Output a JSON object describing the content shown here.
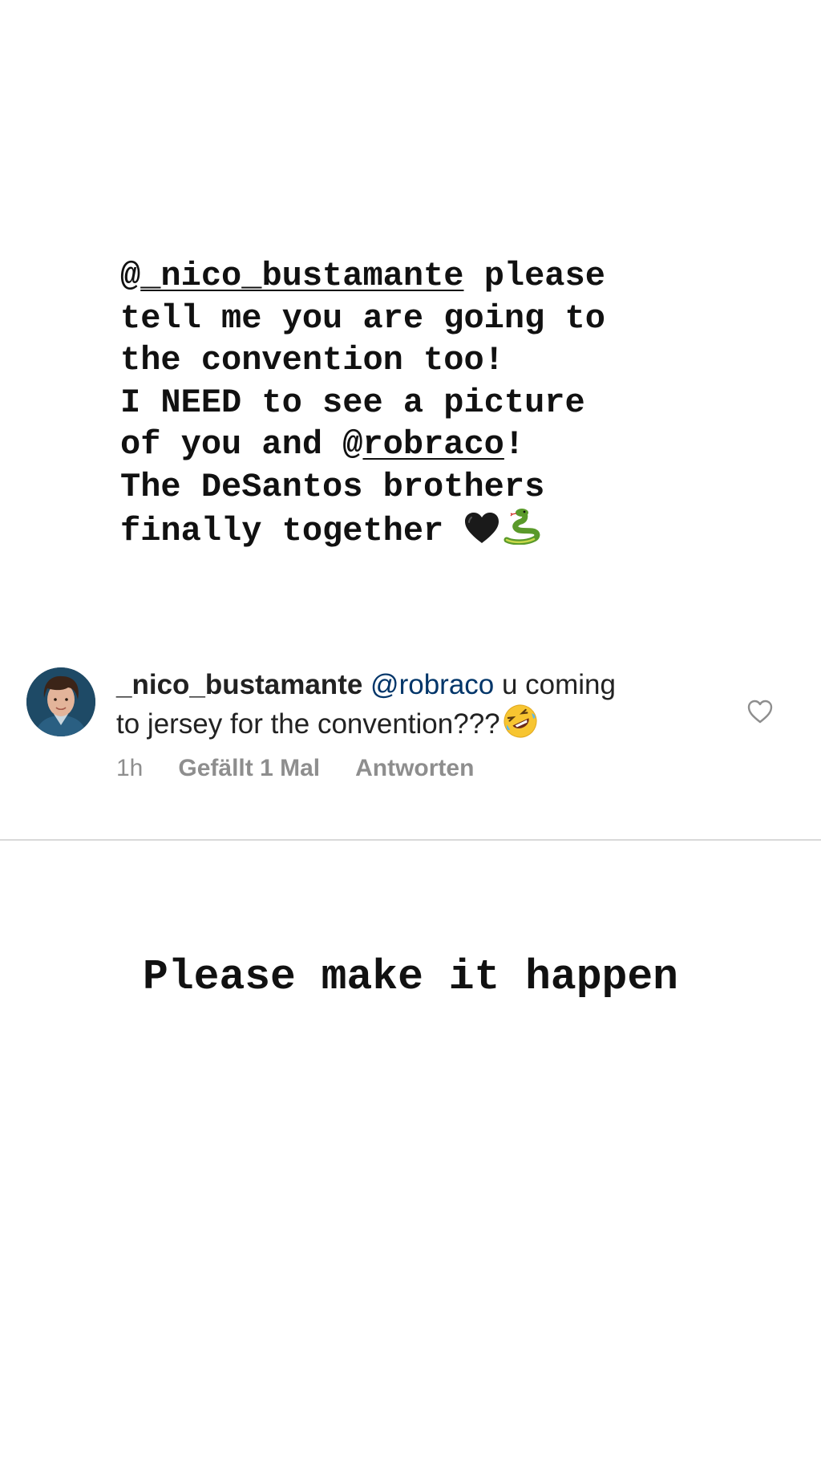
{
  "story": {
    "lines": [
      [
        "@",
        "_nico_bustamante",
        " please"
      ],
      [
        "tell me you are going to"
      ],
      [
        "the convention too!"
      ],
      [
        "I NEED to see a picture"
      ],
      [
        "of you and @",
        "robraco",
        "!"
      ],
      [
        "The DeSantos brothers"
      ],
      [
        "finally together "
      ]
    ],
    "l1_prefix": "@",
    "l1_mention": "_nico_bustamante",
    "l1_suffix": " please",
    "l2": "tell me you are going to",
    "l3": "the convention too!",
    "l4": "I NEED to see a picture",
    "l5_prefix": "of you and @",
    "l5_mention": "robraco",
    "l5_suffix": "!",
    "l6": "The DeSantos brothers",
    "l7": "finally together ",
    "emojis": [
      "black-heart",
      "snake"
    ]
  },
  "comment": {
    "avatar_icon": "profile-photo-avatar",
    "username": "_nico_bustamante",
    "mention": "@robraco",
    "text_part1": " u coming",
    "text_part2": "to jersey for the convention???",
    "emoji": "rolling-on-floor-laughing",
    "time": "1h",
    "likes": "Gefällt 1 Mal",
    "reply": "Antworten",
    "like_icon": "heart-outline-icon"
  },
  "caption": "Please make it happen",
  "colors": {
    "background": "#ffffff",
    "text": "#111111",
    "mention_link": "#003569",
    "meta": "#8e8e8e",
    "divider": "#d9d9d9"
  }
}
